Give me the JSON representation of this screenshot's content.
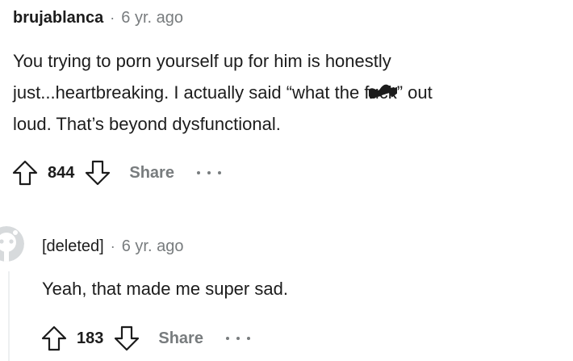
{
  "comments": [
    {
      "author": "brujablanca",
      "separator": "·",
      "age": "6 yr. ago",
      "body": {
        "line1": "You trying to porn yourself up for him is honestly",
        "line2_before": "just...heartbreaking. I actually said “what the f",
        "line2_redacted": "uck",
        "line2_after": "” out",
        "line3": "loud. That’s beyond dysfunctional."
      },
      "score": "844",
      "share_label": "Share"
    },
    {
      "author": "[deleted]",
      "separator": "·",
      "age": "6 yr. ago",
      "body": "Yeah, that made me super sad.",
      "score": "183",
      "share_label": "Share"
    }
  ],
  "colors": {
    "text_primary": "#1c1c1c",
    "text_meta": "#787c7e",
    "thread_line": "#edeff1",
    "avatar_bg": "#d7dadc"
  },
  "icons": {
    "upvote": "upvote-arrow-icon",
    "downvote": "downvote-arrow-icon",
    "more": "more-options-icon",
    "avatar": "default-avatar-icon"
  }
}
